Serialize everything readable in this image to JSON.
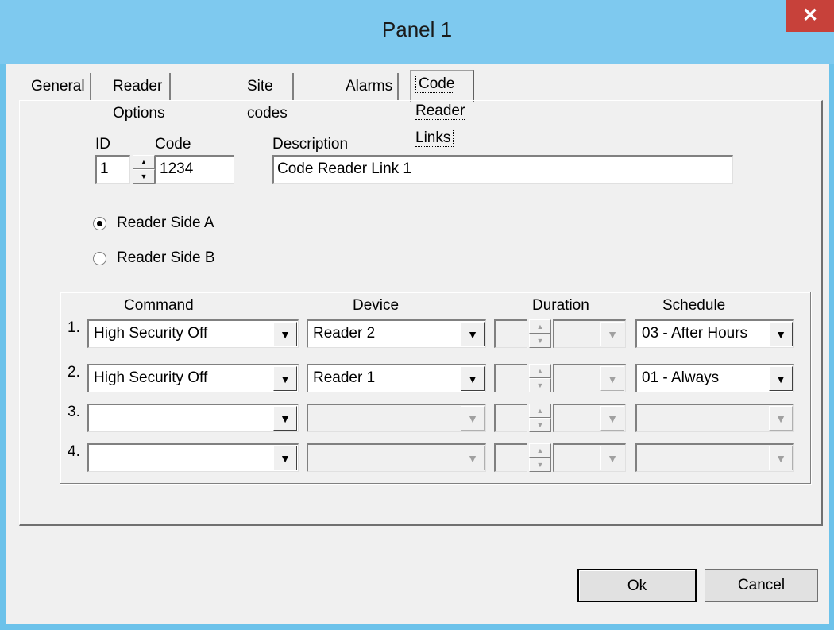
{
  "window": {
    "title": "Panel 1",
    "close_label": "✕"
  },
  "tabs": [
    "General",
    "Reader Options",
    "Site codes",
    "Alarms",
    "Code Reader Links"
  ],
  "active_tab": "Code Reader Links",
  "form": {
    "id_label": "ID",
    "id_value": "1",
    "code_label": "Code",
    "code_value": "1234",
    "description_label": "Description",
    "description_value": "Code Reader Link 1",
    "reader_side_a": "Reader Side A",
    "reader_side_b": "Reader Side B",
    "selected_side": "Reader Side A"
  },
  "links": {
    "headers": {
      "command": "Command",
      "device": "Device",
      "duration": "Duration",
      "schedule": "Schedule"
    },
    "rows": [
      {
        "num": "1.",
        "command": "High Security Off",
        "device": "Reader 2",
        "duration": "",
        "schedule": "03 - After Hours"
      },
      {
        "num": "2.",
        "command": "High Security Off",
        "device": "Reader 1",
        "duration": "",
        "schedule": "01 - Always"
      },
      {
        "num": "3.",
        "command": "",
        "device": "",
        "duration": "",
        "schedule": ""
      },
      {
        "num": "4.",
        "command": "",
        "device": "",
        "duration": "",
        "schedule": ""
      }
    ]
  },
  "buttons": {
    "ok": "Ok",
    "cancel": "Cancel"
  },
  "icons": {
    "close": "close-icon",
    "dropdown": "chevron-down-icon",
    "spin_up": "spin-up-icon",
    "spin_down": "spin-down-icon"
  }
}
